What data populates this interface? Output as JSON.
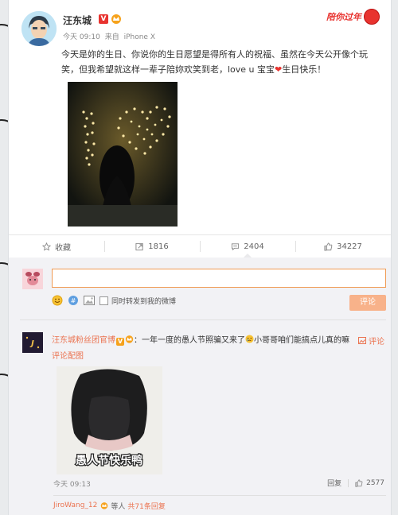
{
  "post": {
    "username": "汪东城",
    "verified_badge": "V",
    "promo_text": "陪你过年",
    "time": "今天 09:10",
    "source_prefix": "来自",
    "source": "iPhone X",
    "text_part1": "今天是妳的生日、你说你的生日愿望是得所有人的祝福、虽然在今天公开像个玩笑，但我希望就这样一辈子陪妳欢笑到老，love u 宝宝",
    "text_heart": "❤",
    "text_part2": "生日快乐！"
  },
  "actions": {
    "favorite_label": "收藏",
    "repost_count": "1816",
    "comment_count": "2404",
    "like_count": "34227"
  },
  "composer": {
    "input_value": "",
    "repost_checkbox_label": "同时转发到我的微博",
    "submit_label": "评论"
  },
  "comment": {
    "author": "汪东城粉丝团官博",
    "badge": "V",
    "colon": "：",
    "text_part1": "一年一度的愚人节照骗又来了",
    "text_part2": "小哥哥咱们能搞点儿真的嘛",
    "link_label": "评论配图",
    "reply_link_label": "评论",
    "image_caption": "愚人节快乐鸭",
    "time": "今天 09:13",
    "reply_label": "回复",
    "like_count": "2577"
  },
  "subreply": {
    "name": "JiroWang_12",
    "suffix": "等人",
    "link": "共71条回复"
  },
  "colors": {
    "accent_orange": "#eb7350",
    "brand_red": "#e8332f",
    "input_border": "#f09a52",
    "submit_disabled": "#f8b28a"
  },
  "icons": {
    "favorite": "star-icon",
    "repost": "repost-icon",
    "comment": "comment-icon",
    "like": "thumbs-up-icon",
    "emoji": "emoji-icon",
    "topic": "topic-icon",
    "image": "image-icon"
  }
}
